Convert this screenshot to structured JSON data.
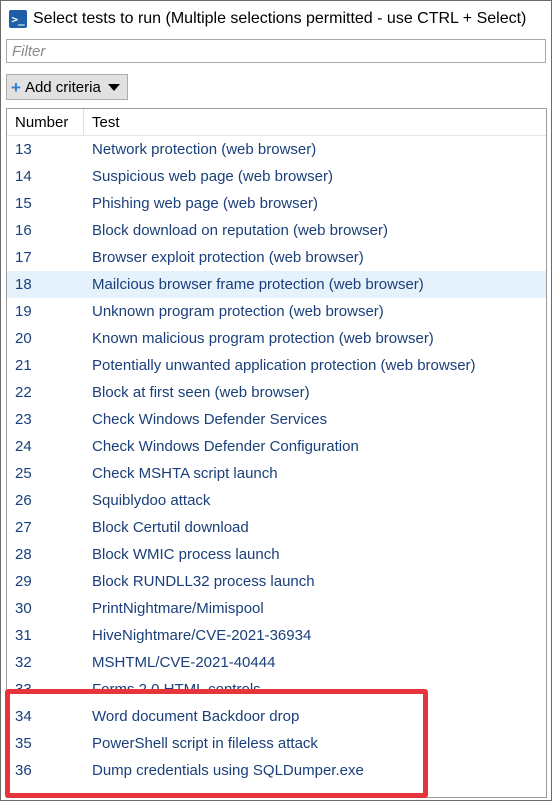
{
  "window": {
    "title": "Select tests to run (Multiple selections permitted - use CTRL + Select)",
    "icon": "powershell-icon"
  },
  "filter": {
    "placeholder": "Filter",
    "value": ""
  },
  "toolbar": {
    "add_criteria_label": "Add criteria"
  },
  "table": {
    "columns": [
      "Number",
      "Test"
    ],
    "rows": [
      {
        "number": "13",
        "test": "Network protection (web browser)"
      },
      {
        "number": "14",
        "test": "Suspicious web page (web browser)"
      },
      {
        "number": "15",
        "test": "Phishing web page (web browser)"
      },
      {
        "number": "16",
        "test": "Block download on reputation (web browser)"
      },
      {
        "number": "17",
        "test": "Browser exploit protection (web browser)"
      },
      {
        "number": "18",
        "test": "Mailcious browser frame protection (web browser)"
      },
      {
        "number": "19",
        "test": "Unknown program protection (web browser)"
      },
      {
        "number": "20",
        "test": "Known malicious program protection (web browser)"
      },
      {
        "number": "21",
        "test": "Potentially unwanted application protection (web browser)"
      },
      {
        "number": "22",
        "test": "Block at first seen (web browser)"
      },
      {
        "number": "23",
        "test": "Check Windows Defender Services"
      },
      {
        "number": "24",
        "test": "Check Windows Defender Configuration"
      },
      {
        "number": "25",
        "test": "Check MSHTA script launch"
      },
      {
        "number": "26",
        "test": "Squiblydoo attack"
      },
      {
        "number": "27",
        "test": "Block Certutil download"
      },
      {
        "number": "28",
        "test": "Block WMIC process launch"
      },
      {
        "number": "29",
        "test": "Block RUNDLL32 process launch"
      },
      {
        "number": "30",
        "test": "PrintNightmare/Mimispool"
      },
      {
        "number": "31",
        "test": "HiveNightmare/CVE-2021-36934"
      },
      {
        "number": "32",
        "test": "MSHTML/CVE-2021-40444"
      },
      {
        "number": "33",
        "test": "Forms 2.0 HTML controls"
      },
      {
        "number": "34",
        "test": "Word document Backdoor drop"
      },
      {
        "number": "35",
        "test": "PowerShell script in fileless attack"
      },
      {
        "number": "36",
        "test": "Dump credentials using SQLDumper.exe"
      }
    ],
    "hovered_row_number": "18"
  },
  "colors": {
    "row_text": "#1a3f7a",
    "hover_bg": "#e5f1fb",
    "highlight_border": "#e8353b"
  }
}
